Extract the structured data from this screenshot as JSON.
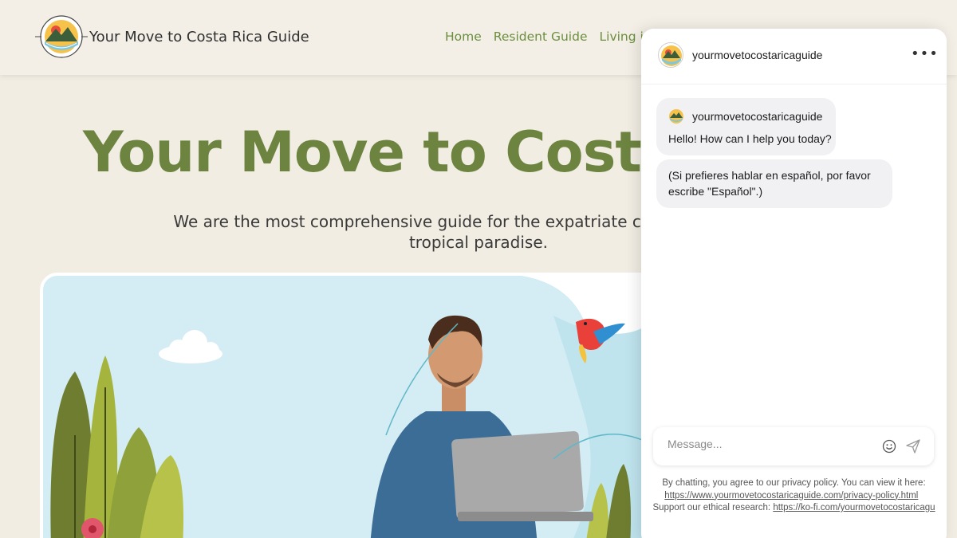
{
  "header": {
    "site_title": "Your Move to Costa Rica Guide",
    "nav": [
      {
        "label": "Home"
      },
      {
        "label": "Resident Guide"
      },
      {
        "label": "Living in C"
      }
    ]
  },
  "hero": {
    "title": "Your Move to Costa R",
    "subtitle_line1": "We are the most comprehensive guide for the expatriate community looking",
    "subtitle_line2": "tropical paradise."
  },
  "chat": {
    "bot_name": "yourmovetocostaricaguide",
    "more_label": "•••",
    "messages": [
      {
        "author": "yourmovetocostaricaguide",
        "text": "Hello! How can I help you today?"
      },
      {
        "text": "(Si prefieres hablar en español, por favor escribe \"Español\".)"
      }
    ],
    "input_placeholder": "Message...",
    "disclaimer_text": "By chatting, you agree to our privacy policy. You can view it here:",
    "privacy_link": "https://www.yourmovetocostaricaguide.com/privacy-policy.html",
    "support_text": "Support our ethical research:",
    "support_link": "https://ko-fi.com/yourmovetocostaricagu"
  },
  "colors": {
    "accent": "#6d8440",
    "nav": "#6b8f3e",
    "background": "#f1ede3"
  }
}
